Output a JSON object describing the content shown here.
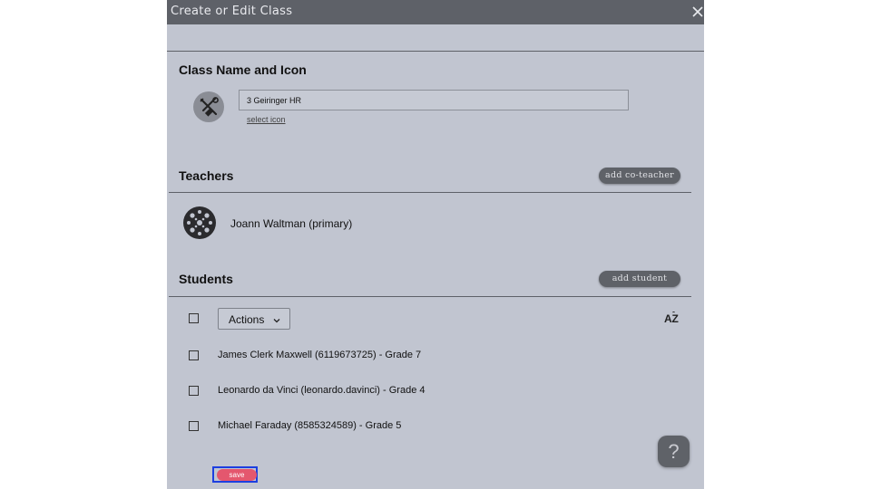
{
  "dialog": {
    "title": "Create or Edit Class",
    "close_icon": "close-icon"
  },
  "class_section": {
    "title": "Class Name and Icon",
    "icon": "tools-icon",
    "name_value": "3 Geiringer HR",
    "select_icon_label": "select icon"
  },
  "teachers_section": {
    "title": "Teachers",
    "add_button_label": "add co-teacher",
    "teachers": [
      {
        "name": "Joann Waltman (primary)",
        "avatar": "patterned-avatar-icon"
      }
    ]
  },
  "students_section": {
    "title": "Students",
    "add_button_label": "add student",
    "actions_label": "Actions",
    "sort_icon": "sort-az-icon",
    "students": [
      {
        "label": "James Clerk Maxwell (6119673725) - Grade 7"
      },
      {
        "label": "Leonardo da Vinci (leonardo.davinci) - Grade 4"
      },
      {
        "label": "Michael Faraday (8585324589) - Grade 5"
      }
    ]
  },
  "help": {
    "label": "?"
  },
  "footer": {
    "save_label": "save"
  },
  "colors": {
    "titlebar": "#5e6168",
    "background": "#c1c5d0",
    "button": "#5f6268",
    "save": "#e4576e",
    "focus_outline": "#1d3fe0"
  }
}
